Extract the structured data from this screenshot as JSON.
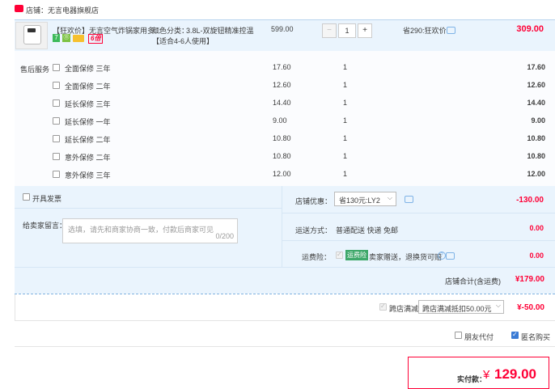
{
  "shop": {
    "label": "店铺：",
    "name": "无言电器旗舰店"
  },
  "item": {
    "title": "【狂欢价】无言空气炸锅家用多...",
    "badges": [
      "7",
      "⑪",
      "",
      "6倍"
    ],
    "sku_label": "颜色分类：",
    "sku_value": "3.8L-双旋钮精准控温",
    "sku_value2": "【适合4-6人使用】",
    "price": "599.00",
    "qty": "1",
    "qty_minus": "−",
    "qty_plus": "+",
    "discount": "省290:狂欢价",
    "subtotal": "309.00"
  },
  "service": {
    "label": "售后服务",
    "rows": [
      {
        "name": "全面保修 三年",
        "price": "17.60",
        "qty": "1",
        "sub": "17.60"
      },
      {
        "name": "全面保修 二年",
        "price": "12.60",
        "qty": "1",
        "sub": "12.60"
      },
      {
        "name": "延长保修 三年",
        "price": "14.40",
        "qty": "1",
        "sub": "14.40"
      },
      {
        "name": "延长保修 一年",
        "price": "9.00",
        "qty": "1",
        "sub": "9.00"
      },
      {
        "name": "延长保修 二年",
        "price": "10.80",
        "qty": "1",
        "sub": "10.80"
      },
      {
        "name": "意外保修 二年",
        "price": "10.80",
        "qty": "1",
        "sub": "10.80"
      },
      {
        "name": "意外保修 三年",
        "price": "12.00",
        "qty": "1",
        "sub": "12.00"
      }
    ]
  },
  "invoice": {
    "label": "开具发票"
  },
  "message": {
    "label": "给卖家留言：",
    "placeholder": "选填，请先和商家协商一致，付款后商家可见",
    "count": "0/200"
  },
  "shop_discount": {
    "label": "店铺优惠：",
    "value": "省130元:LY2",
    "amount": "-130.00"
  },
  "shipping": {
    "label": "运送方式：",
    "value": "普通配送 快递 免邮",
    "amount": "0.00"
  },
  "insurance": {
    "label": "运费险：",
    "badge": "运费险",
    "value": "卖家赠送，退换货可赔",
    "amount": "0.00"
  },
  "shop_total": {
    "label": "店铺合计(含运费)",
    "amount": "¥179.00"
  },
  "cross_store": {
    "label": "跨店满减",
    "value": "跨店满减抵扣50.00元",
    "amount": "¥-50.00"
  },
  "options": {
    "friend_pay": "朋友代付",
    "anonymous": "匿名购买"
  },
  "pay": {
    "label": "实付款：",
    "currency": "¥",
    "amount": "129.00"
  },
  "colors": {
    "accent": "#ff0036",
    "blue_bg": "#eaf4fd",
    "border": "#b8d4ee"
  }
}
